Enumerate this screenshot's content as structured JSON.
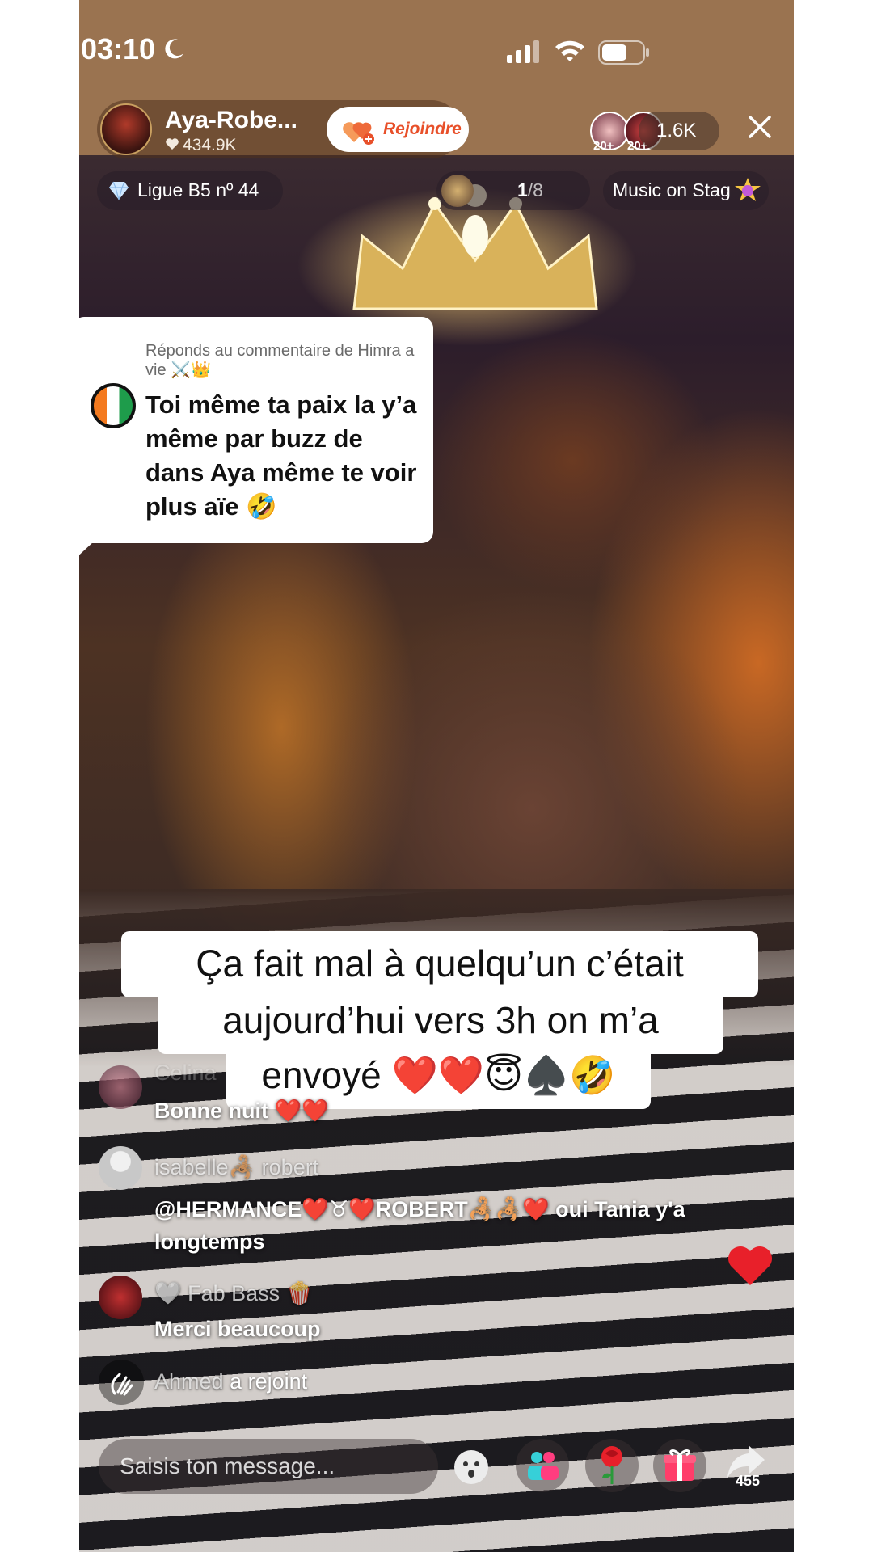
{
  "status_bar": {
    "time": "03:10"
  },
  "host": {
    "name": "Aya-Robe...",
    "likes": "434.9K",
    "join_label": "Rejoindre"
  },
  "viewers": {
    "badge_1": "20+",
    "badge_2": "20+",
    "count": "1.6K"
  },
  "info_row": {
    "league": "Ligue B5 nº 44",
    "rank_current": "1",
    "rank_total": "/8",
    "music": "Music on Stag"
  },
  "reply_card": {
    "context": "Réponds au commentaire de Himra a vie ⚔️👑",
    "text": "Toi même ta paix la y’a même par buzz de dans Aya même te voir plus aïe 🤣"
  },
  "caption": {
    "line1": "Ça fait mal à quelqu’un c’était",
    "line2": "aujourd’hui vers 3h on m’a",
    "line3": "envoyé ❤️❤️😇♠️🤣"
  },
  "chat": [
    {
      "name": "Celina",
      "message": "Bonne nuit ❤️❤️"
    },
    {
      "name": "isabelle🦂 robert",
      "message": "@HERMANCE❤️♉❤️ROBERT🦂🦂❤️ oui Tania y'a longtemps"
    },
    {
      "name": "🤍 Fab Bass 🍿",
      "message": "Merci beaucoup"
    }
  ],
  "join_event": {
    "user": "Ahmed",
    "action": "a rejoint"
  },
  "composer": {
    "placeholder": "Saisis ton message...",
    "share_count": "455"
  },
  "colors": {
    "top_band": "#9a7350",
    "join_accent": "#e8502a",
    "heart": "#e8202a"
  }
}
